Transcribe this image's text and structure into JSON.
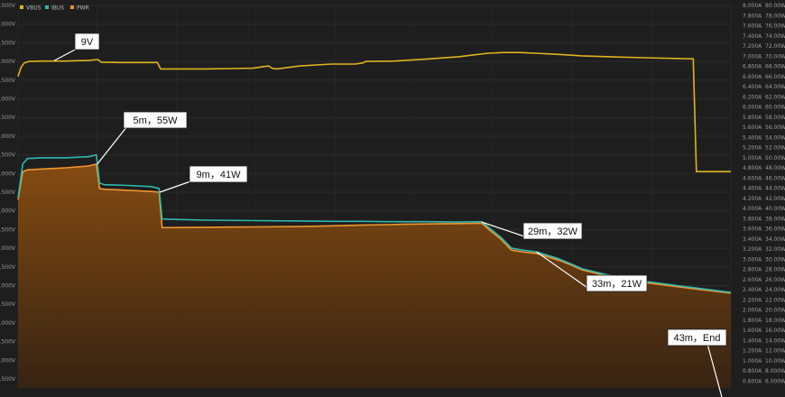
{
  "chart_data": {
    "type": "line",
    "legend": [
      {
        "name": "VBUS",
        "color": "#e0b21f"
      },
      {
        "name": "IBUS",
        "color": "#2fb8b0"
      },
      {
        "name": "PWR",
        "color": "#f0962e"
      }
    ],
    "legend_position": "top-left",
    "grid": true,
    "time_unit": "min",
    "x_range": [
      0,
      45.5
    ],
    "axes": {
      "left_ticks": [
        {
          "value": 10.5,
          "label": "0.500V"
        },
        {
          "value": 10.0,
          "label": "1.000V"
        },
        {
          "value": 9.5,
          "label": "9.500V"
        },
        {
          "value": 9.0,
          "label": "9.000V"
        },
        {
          "value": 8.5,
          "label": "8.500V"
        },
        {
          "value": 8.0,
          "label": "8.000V"
        },
        {
          "value": 7.5,
          "label": "7.500V"
        },
        {
          "value": 7.0,
          "label": "7.000V"
        },
        {
          "value": 6.5,
          "label": "6.500V"
        },
        {
          "value": 6.0,
          "label": "6.000V"
        },
        {
          "value": 5.5,
          "label": "5.500V"
        },
        {
          "value": 5.0,
          "label": "5.000V"
        },
        {
          "value": 4.5,
          "label": "4.500V"
        },
        {
          "value": 4.0,
          "label": "4.000V"
        },
        {
          "value": 3.5,
          "label": "3.500V"
        },
        {
          "value": 3.0,
          "label": "3.000V"
        },
        {
          "value": 2.5,
          "label": "2.500V"
        },
        {
          "value": 2.0,
          "label": "2.000V"
        },
        {
          "value": 1.5,
          "label": "1.500V"
        },
        {
          "value": 1.0,
          "label": "1.000V"
        },
        {
          "value": 0.5,
          "label": "0.500V"
        }
      ],
      "current_ticks": [
        "8.000A",
        "7.800A",
        "7.600A",
        "7.400A",
        "7.200A",
        "7.000A",
        "6.800A",
        "6.600A",
        "6.400A",
        "6.200A",
        "6.000A",
        "5.800A",
        "5.600A",
        "5.400A",
        "5.200A",
        "5.000A",
        "4.800A",
        "4.600A",
        "4.400A",
        "4.200A",
        "4.000A",
        "3.800A",
        "3.600A",
        "3.400A",
        "3.200A",
        "3.000A",
        "2.800A",
        "2.600A",
        "2.400A",
        "2.200A",
        "2.000A",
        "1.800A",
        "1.600A",
        "1.400A",
        "1.200A",
        "1.000A",
        "0.800A",
        "0.600A"
      ],
      "power_ticks": [
        "80.00W",
        "78.00W",
        "76.00W",
        "74.00W",
        "72.00W",
        "70.00W",
        "68.00W",
        "66.00W",
        "64.00W",
        "62.00W",
        "60.00W",
        "58.00W",
        "56.00W",
        "54.00W",
        "52.00W",
        "50.00W",
        "48.00W",
        "46.00W",
        "44.00W",
        "42.00W",
        "40.00W",
        "38.00W",
        "36.00W",
        "34.00W",
        "32.00W",
        "30.00W",
        "28.00W",
        "26.00W",
        "24.00W",
        "22.00W",
        "20.00W",
        "18.00W",
        "16.00W",
        "14.00W",
        "12.00W",
        "10.00W",
        "8.000W",
        "6.000W"
      ]
    },
    "series": [
      {
        "name": "VBUS",
        "color": "#e0b21f",
        "fill": false,
        "x": [
          0,
          0.2,
          0.4,
          0.7,
          1.5,
          3,
          4.5,
          5.1,
          5.3,
          6.5,
          8,
          8.9,
          9.1,
          12,
          15,
          16,
          16.2,
          16.5,
          18,
          20,
          21.5,
          22,
          22.2,
          24,
          26,
          28,
          29,
          30,
          31,
          32,
          33,
          34,
          36,
          38,
          40,
          42,
          43,
          43.1,
          43.3,
          45.5
        ],
        "y": [
          8.6,
          8.85,
          8.96,
          9.0,
          9.01,
          9.01,
          9.03,
          9.05,
          8.98,
          8.97,
          8.97,
          8.97,
          8.8,
          8.8,
          8.82,
          8.88,
          8.82,
          8.8,
          8.88,
          8.93,
          8.93,
          8.96,
          9.0,
          9.01,
          9.06,
          9.12,
          9.17,
          9.22,
          9.24,
          9.24,
          9.22,
          9.2,
          9.15,
          9.12,
          9.1,
          9.08,
          9.07,
          9.07,
          6.05,
          6.05
        ]
      },
      {
        "name": "IBUS",
        "color": "#2fb8b0",
        "fill": false,
        "x": [
          0,
          0.3,
          0.6,
          1.5,
          3,
          4.5,
          5.0,
          5.2,
          5.5,
          7,
          8.5,
          9.0,
          9.2,
          12,
          15,
          18,
          20,
          22,
          23.5,
          24.5,
          26,
          28,
          29.6,
          30.2,
          30.8,
          31.5,
          32.2,
          33.1,
          34.5,
          35.2,
          36,
          37.5,
          39,
          41,
          43,
          45.5
        ],
        "y": [
          5.35,
          6.25,
          6.4,
          6.42,
          6.42,
          6.45,
          6.5,
          5.75,
          5.7,
          5.68,
          5.65,
          5.6,
          4.78,
          4.75,
          4.74,
          4.73,
          4.72,
          4.72,
          4.71,
          4.71,
          4.71,
          4.7,
          4.71,
          4.5,
          4.3,
          4.0,
          3.95,
          3.9,
          3.72,
          3.6,
          3.45,
          3.3,
          3.17,
          3.06,
          2.95,
          2.82
        ]
      },
      {
        "name": "PWR",
        "color": "#f0962e",
        "fill": true,
        "x": [
          0,
          0.3,
          0.6,
          1.5,
          3,
          4.5,
          5.0,
          5.2,
          5.5,
          7,
          8.5,
          9.0,
          9.2,
          12,
          15,
          18,
          20,
          22,
          23.5,
          24.5,
          26,
          28,
          29.6,
          30.2,
          30.8,
          31.5,
          32.2,
          33.1,
          34.5,
          35.2,
          36,
          37.5,
          39,
          41,
          43,
          45.5
        ],
        "y": [
          5.3,
          6.05,
          6.1,
          6.12,
          6.15,
          6.2,
          6.25,
          5.6,
          5.58,
          5.55,
          5.52,
          5.5,
          4.55,
          4.56,
          4.57,
          4.58,
          4.6,
          4.62,
          4.63,
          4.64,
          4.65,
          4.66,
          4.67,
          4.45,
          4.25,
          3.95,
          3.9,
          3.86,
          3.68,
          3.57,
          3.42,
          3.27,
          3.13,
          3.03,
          2.92,
          2.8
        ]
      }
    ],
    "annotations": [
      {
        "label": "9V",
        "x": 2.3,
        "y": 9.02
      },
      {
        "label": "5m，55W",
        "x": 5.05,
        "y": 6.25
      },
      {
        "label": "9m，41W",
        "x": 9.05,
        "y": 5.5
      },
      {
        "label": "29m，32W",
        "x": 29.6,
        "y": 4.7
      },
      {
        "label": "33m，21W",
        "x": 33.1,
        "y": 3.9
      },
      {
        "label": "43m，End",
        "x": 43.8,
        "y": 2.85
      }
    ]
  }
}
